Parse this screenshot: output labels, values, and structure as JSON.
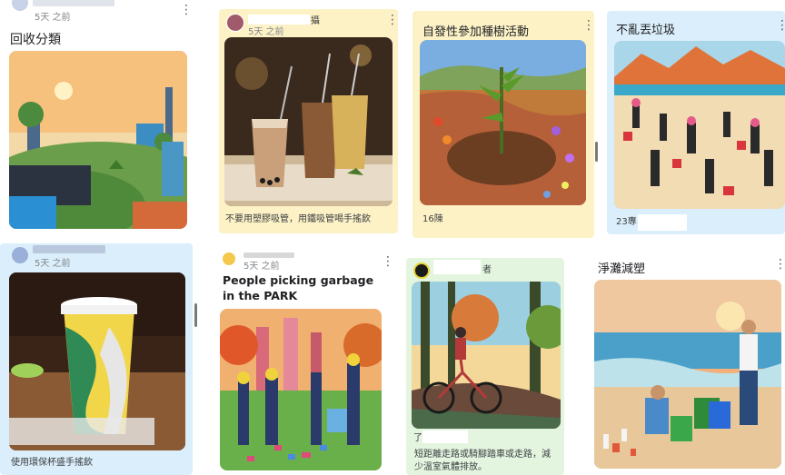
{
  "posts": [
    {
      "time": "5天 之前",
      "title": "回收分類"
    },
    {
      "time": "5天 之前",
      "name_tail": "攝",
      "caption": "不要用塑膠吸管，用鐵吸管喝手搖飲"
    },
    {
      "title": "自發性參加種樹活動",
      "count": "16陳"
    },
    {
      "title": "不亂丟垃圾",
      "count": "23專"
    },
    {
      "time": "5天 之前"
    },
    {
      "time": "5天 之前",
      "title": "People picking garbage in the PARK"
    },
    {
      "name_tail": "者",
      "count": "了",
      "caption": "短距離走路或騎腳踏車或走路，減少溫室氣體排放。"
    },
    {
      "title": "淨灘減塑"
    },
    {
      "caption": "使用環保杯盛手搖飲"
    }
  ],
  "icons": {
    "menu": "more-vert-icon",
    "avatar": "user-avatar-icon"
  },
  "colors": {
    "yellow_card": "#fdf2c6",
    "green_card": "#e3f5df",
    "blue_card": "#dbeefb",
    "white_card": "#ffffff"
  }
}
